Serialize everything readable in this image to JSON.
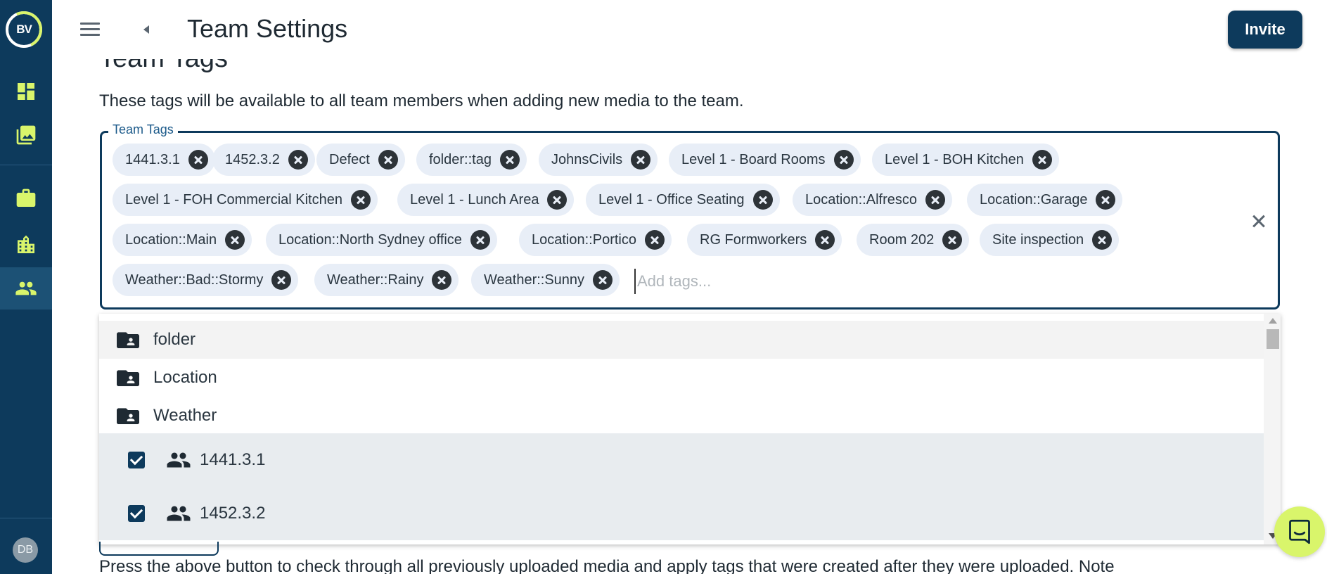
{
  "sidebar": {
    "logo_text": "BV",
    "items": [
      {
        "name": "dashboard",
        "icon": "dashboard-icon"
      },
      {
        "name": "media",
        "icon": "photo-library-icon"
      },
      {
        "name": "projects",
        "icon": "briefcase-icon"
      },
      {
        "name": "organisation",
        "icon": "building-icon"
      },
      {
        "name": "team",
        "icon": "people-icon",
        "active": true
      }
    ],
    "avatar_initials": "DB"
  },
  "header": {
    "title": "Team Settings",
    "invite_label": "Invite"
  },
  "section": {
    "title": "Team Tags",
    "description": "These tags will be available to all team members when adding new media to the team."
  },
  "tags_field": {
    "legend": "Team Tags",
    "placeholder": "Add tags...",
    "chips": [
      "1441.3.1",
      "1452.3.2",
      "Defect",
      "folder::tag",
      "JohnsCivils",
      "Level 1 - Board Rooms",
      "Level 1 - BOH Kitchen",
      "Level 1 - FOH Commercial Kitchen",
      "Level 1 - Lunch Area",
      "Level 1 - Office Seating",
      "Location::Alfresco",
      "Location::Garage",
      "Location::Main",
      "Location::North Sydney office",
      "Location::Portico",
      "RG Formworkers",
      "Room 202",
      "Site inspection",
      "Weather::Bad::Stormy",
      "Weather::Rainy",
      "Weather::Sunny"
    ]
  },
  "dropdown": {
    "folders": [
      "folder",
      "Location",
      "Weather"
    ],
    "options": [
      {
        "label": "1441.3.1",
        "checked": true
      },
      {
        "label": "1452.3.2",
        "checked": true
      }
    ]
  },
  "bottom_text": "Press the above button to check through all previously uploaded media and apply tags that were created after they were uploaded. Note",
  "colors": {
    "primary": "#0d3a5c",
    "accent": "#d9f56b",
    "chip_bg": "#e8eef7"
  }
}
